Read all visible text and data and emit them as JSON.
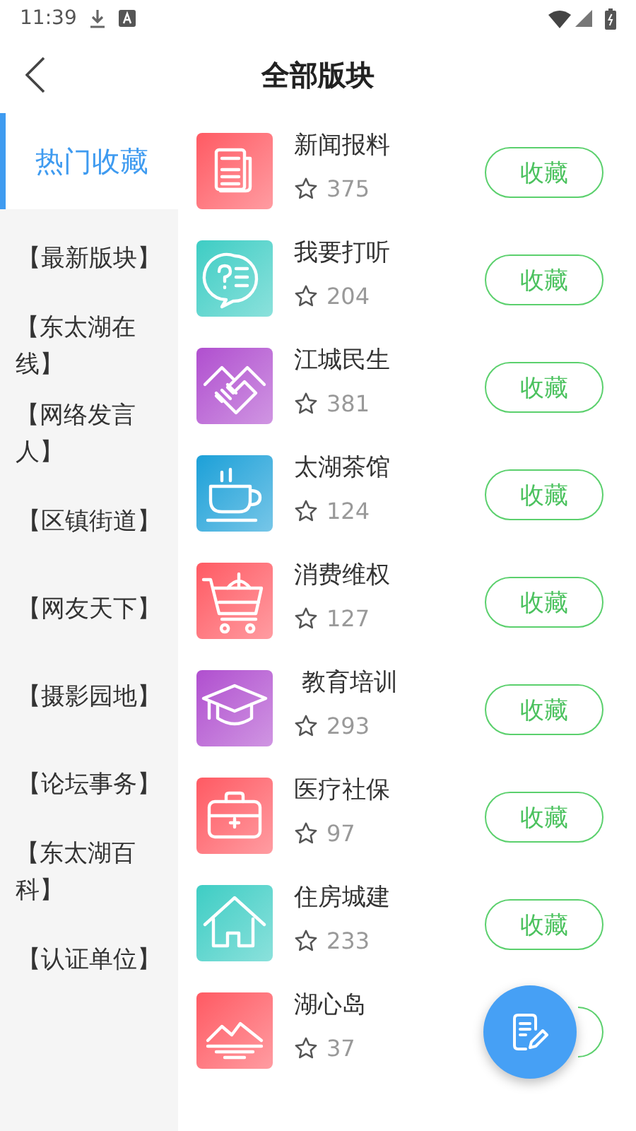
{
  "status_bar": {
    "time": "11:39"
  },
  "header": {
    "title": "全部版块"
  },
  "sidebar": {
    "items": [
      {
        "label": "热门收藏",
        "selected": true
      },
      {
        "label": "【最新版块】",
        "selected": false
      },
      {
        "label": "【东太湖在线】",
        "selected": false
      },
      {
        "label": "【网络发言人】",
        "selected": false
      },
      {
        "label": "【区镇街道】",
        "selected": false
      },
      {
        "label": "【网友天下】",
        "selected": false
      },
      {
        "label": "【摄影园地】",
        "selected": false
      },
      {
        "label": "【论坛事务】",
        "selected": false
      },
      {
        "label": "【东太湖百科】",
        "selected": false
      },
      {
        "label": "【认证单位】",
        "selected": false
      }
    ]
  },
  "forums": [
    {
      "name": "新闻报料",
      "count": "375",
      "color": "#ff5a63",
      "button": "收藏"
    },
    {
      "name": "我要打听",
      "count": "204",
      "color": "#3ecdc4",
      "button": "收藏"
    },
    {
      "name": "江城民生",
      "count": "381",
      "color": "#b04fcf",
      "button": "收藏"
    },
    {
      "name": "太湖茶馆",
      "count": "124",
      "color": "#1ca0d8",
      "button": "收藏"
    },
    {
      "name": "消费维权",
      "count": "127",
      "color": "#ff5a63",
      "button": "收藏"
    },
    {
      "name": " 教育培训",
      "count": "293",
      "color": "#b04fcf",
      "button": "收藏"
    },
    {
      "name": "医疗社保",
      "count": "97",
      "color": "#ff5a63",
      "button": "收藏"
    },
    {
      "name": "住房城建",
      "count": "233",
      "color": "#3ecdc4",
      "button": "收藏"
    },
    {
      "name": "湖心岛",
      "count": "37",
      "color": "#ff5a63"
    }
  ]
}
